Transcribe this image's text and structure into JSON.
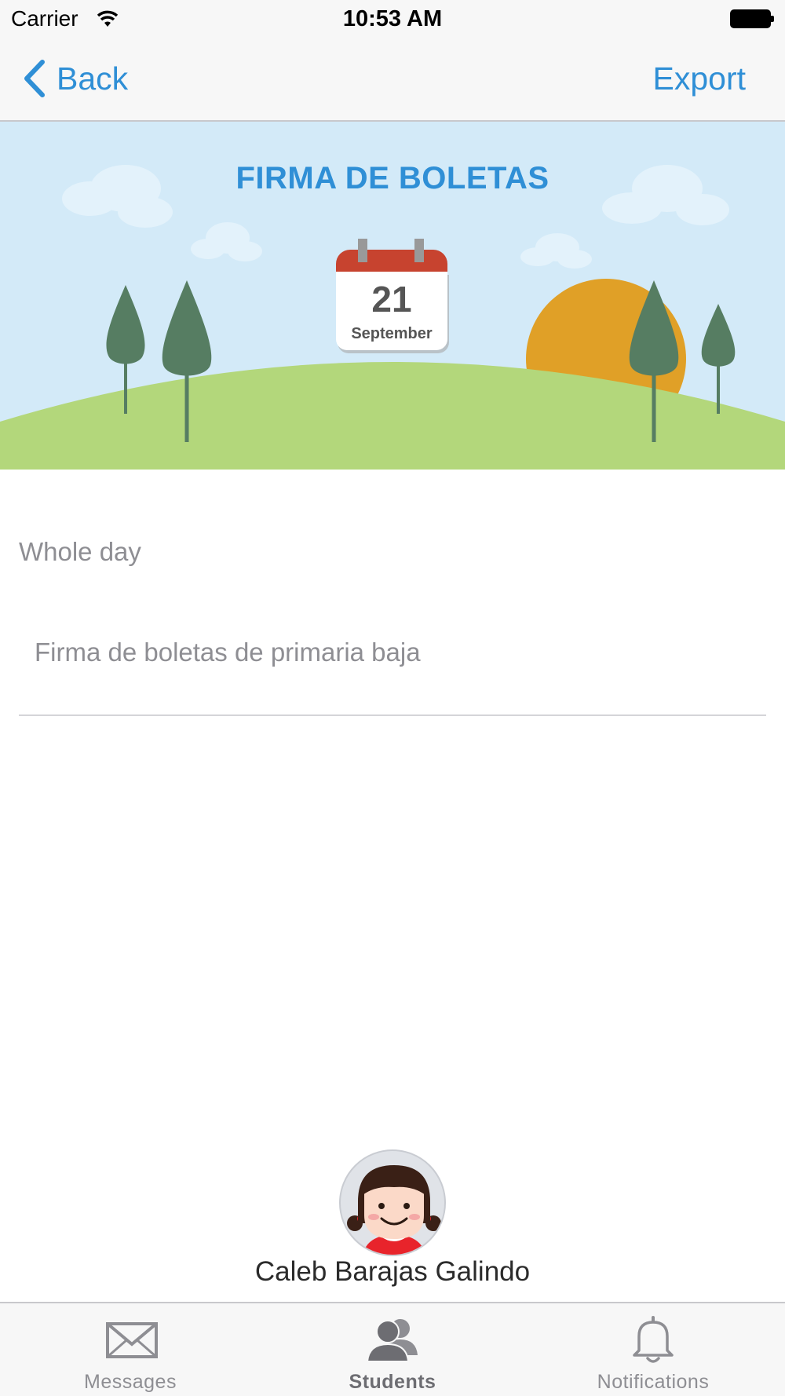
{
  "status_bar": {
    "carrier": "Carrier",
    "time": "10:53 AM"
  },
  "nav": {
    "back_label": "Back",
    "export_label": "Export"
  },
  "banner": {
    "title": "FIRMA DE BOLETAS",
    "day": "21",
    "month": "September"
  },
  "event": {
    "time_label": "Whole day",
    "description": "Firma de boletas de primaria baja"
  },
  "student": {
    "name": "Caleb Barajas Galindo"
  },
  "tabs": [
    {
      "label": "Messages",
      "icon": "envelope-icon",
      "active": false
    },
    {
      "label": "Students",
      "icon": "people-icon",
      "active": true
    },
    {
      "label": "Notifications",
      "icon": "bell-icon",
      "active": false
    }
  ],
  "colors": {
    "accent": "#2f8fd6",
    "sky": "#d3eaf8",
    "hill": "#b3d77b",
    "tree": "#567d62",
    "sun": "#e0a027",
    "calendar_red": "#c7432f"
  }
}
